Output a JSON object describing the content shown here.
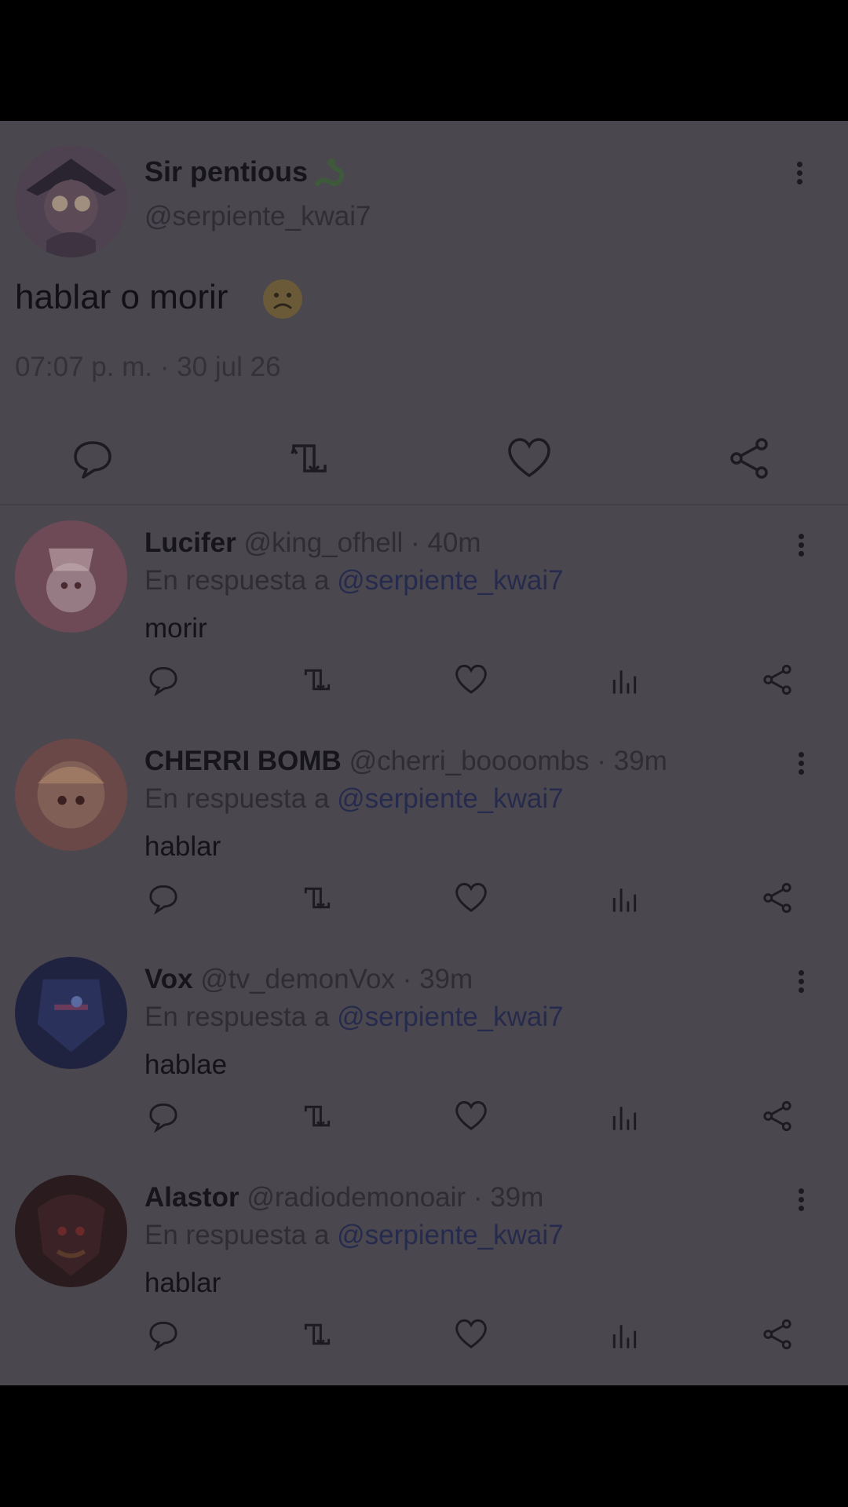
{
  "main_tweet": {
    "author_name": "Sir pentious",
    "author_handle": "@serpiente_kwai7",
    "text": "hablar o morir",
    "timestamp": "07:07 p. m. · 30 jul 26",
    "avatar_color": "#5a4a57"
  },
  "replies": [
    {
      "name": "Lucifer",
      "handle": "@king_ofhell",
      "time": "· 40m",
      "reply_prefix": "En respuesta a ",
      "reply_to": "@serpiente_kwai7",
      "text": "morir",
      "avatar_color": "#6e4a56"
    },
    {
      "name": "CHERRI BOMB",
      "handle": "@cherri_boooombs",
      "time": "· 39m",
      "reply_prefix": "En respuesta a ",
      "reply_to": "@serpiente_kwai7",
      "text": "hablar",
      "avatar_color": "#6a4848"
    },
    {
      "name": "Vox",
      "handle": "@tv_demonVox",
      "time": "· 39m",
      "reply_prefix": "En respuesta a ",
      "reply_to": "@serpiente_kwai7",
      "text": "hablae",
      "avatar_color": "#1f2340"
    },
    {
      "name": "Alastor",
      "handle": "@radiodemonoair",
      "time": "· 39m",
      "reply_prefix": "En respuesta a ",
      "reply_to": "@serpiente_kwai7",
      "text": "hablar",
      "avatar_color": "#2a1b1e"
    }
  ],
  "icons": {
    "reply": "reply-icon",
    "retweet": "retweet-icon",
    "like": "heart-icon",
    "stats": "stats-icon",
    "share": "share-icon",
    "more": "more-vertical-icon"
  },
  "colors": {
    "background": "#4a474e",
    "text": "#161519",
    "muted": "#302d35",
    "mention": "#262b4d"
  }
}
